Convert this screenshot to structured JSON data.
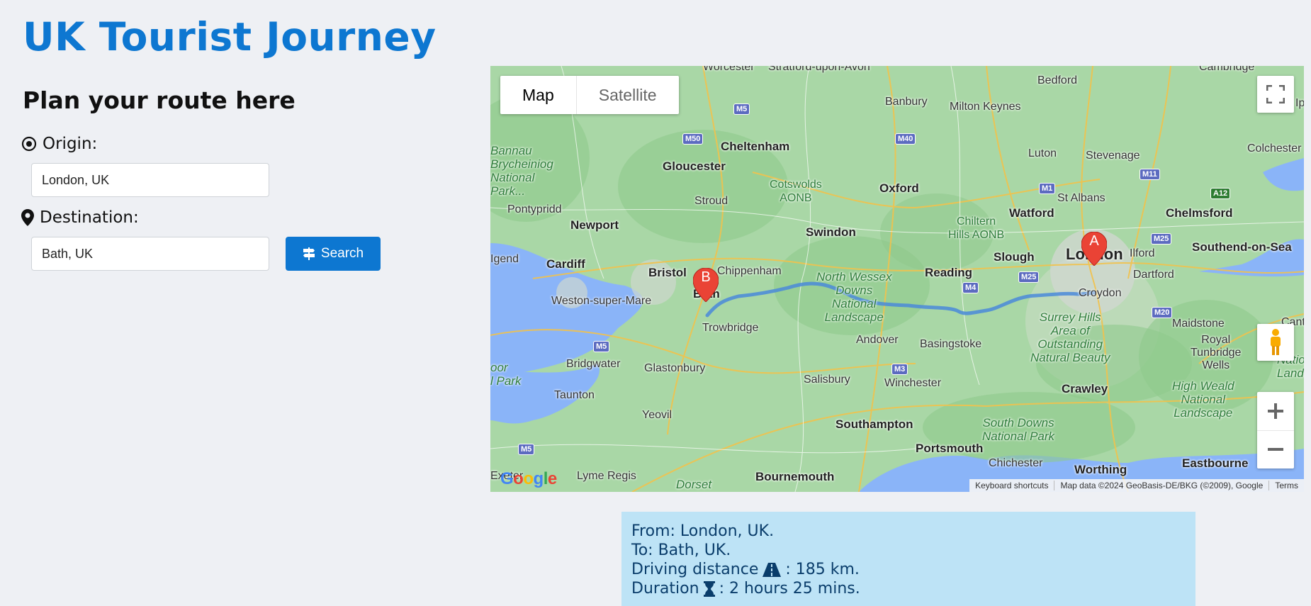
{
  "header": {
    "title": "UK Tourist Journey"
  },
  "form": {
    "heading": "Plan your route here",
    "origin_label": "Origin:",
    "origin_value": "London, UK",
    "destination_label": "Destination:",
    "destination_value": "Bath, UK",
    "search_label": "Search"
  },
  "map": {
    "type_map": "Map",
    "type_satellite": "Satellite",
    "marker_a": "A",
    "marker_b": "B",
    "attribution": {
      "shortcuts": "Keyboard shortcuts",
      "data": "Map data ©2024 GeoBasis-DE/BKG (©2009), Google",
      "terms": "Terms"
    },
    "logo": "Google",
    "places": {
      "worcester": "Worcester",
      "stratford": "Stratford-upon-Avon",
      "cambridge": "Cambridge",
      "bedford": "Bedford",
      "banbury": "Banbury",
      "milton_keynes": "Milton Keynes",
      "cheltenham": "Cheltenham",
      "gloucester": "Gloucester",
      "luton": "Luton",
      "stevenage": "Stevenage",
      "colchester": "Colchester",
      "bannau": "Bannau\nBrycheiniog\nNational\nPark...",
      "cotswolds": "Cotswolds\nAONB",
      "oxford": "Oxford",
      "stroud": "Stroud",
      "st_albans": "St Albans",
      "chelmsford": "Chelmsford",
      "watford": "Watford",
      "chiltern": "Chiltern\nHills AONB",
      "pontypridd": "Pontypridd",
      "newport": "Newport",
      "swindon": "Swindon",
      "london": "London",
      "southend": "Southend-on-Sea",
      "cardiff": "Cardiff",
      "bristol": "Bristol",
      "chippenham": "Chippenham",
      "slough": "Slough",
      "ilford": "Ilford",
      "reading": "Reading",
      "dartford": "Dartford",
      "north_wessex": "North Wessex\nDowns\nNational\nLandscape",
      "bath": "Bath",
      "croydon": "Croydon",
      "weston": "Weston-super-Mare",
      "trowbridge": "Trowbridge",
      "surrey_hills": "Surrey Hills\nArea of\nOutstanding\nNatural Beauty",
      "maidstone": "Maidstone",
      "andover": "Andover",
      "basingstoke": "Basingstoke",
      "royal_tw": "Royal\nTunbridge\nWells",
      "bridgwater": "Bridgwater",
      "glastonbury": "Glastonbury",
      "salisbury": "Salisbury",
      "winchester": "Winchester",
      "crawley": "Crawley",
      "high_weald": "High Weald\nNational\nLandscape",
      "taunton": "Taunton",
      "yeovil": "Yeovil",
      "southampton": "Southampton",
      "south_downs": "South Downs\nNational Park",
      "portsmouth": "Portsmouth",
      "chichester": "Chichester",
      "worthing": "Worthing",
      "eastbourne": "Eastbourne",
      "lyme": "Lyme Regis",
      "dorset": "Dorset",
      "bournemouth": "Bournemouth",
      "exeter": "Exeter",
      "igend": "Igend",
      "oor_park": "oor\nl Park",
      "ip": "Ip",
      "cante": "Cante",
      "nationa": "Nationa\nLandsca"
    },
    "shields": {
      "m5a": "M5",
      "m50": "M50",
      "m40": "M40",
      "m1": "M1",
      "m11": "M11",
      "a12": "A12",
      "m25a": "M25",
      "m25b": "M25",
      "m4": "M4",
      "m20": "M20",
      "m5b": "M5",
      "m3": "M3",
      "m5c": "M5"
    }
  },
  "summary": {
    "from": "From: London, UK.",
    "to": "To: Bath, UK.",
    "distance_prefix": "Driving distance",
    "distance_value": ": 185 km.",
    "duration_prefix": "Duration",
    "duration_value": ": 2 hours 25 mins."
  }
}
